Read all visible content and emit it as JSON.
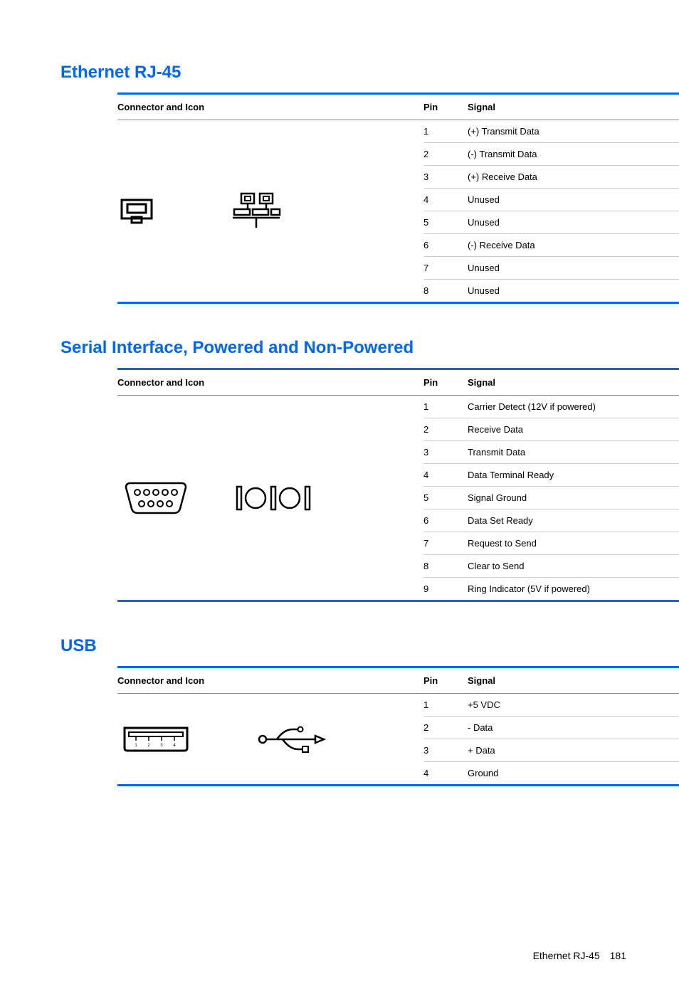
{
  "sections": [
    {
      "heading": "Ethernet RJ-45",
      "header": {
        "connector": "Connector and Icon",
        "pin": "Pin",
        "signal": "Signal"
      },
      "rows": [
        {
          "pin": "1",
          "signal": "(+) Transmit Data"
        },
        {
          "pin": "2",
          "signal": "(-) Transmit Data"
        },
        {
          "pin": "3",
          "signal": "(+) Receive Data"
        },
        {
          "pin": "4",
          "signal": "Unused"
        },
        {
          "pin": "5",
          "signal": "Unused"
        },
        {
          "pin": "6",
          "signal": "(-) Receive Data"
        },
        {
          "pin": "7",
          "signal": "Unused"
        },
        {
          "pin": "8",
          "signal": "Unused"
        }
      ]
    },
    {
      "heading": "Serial Interface, Powered and Non-Powered",
      "header": {
        "connector": "Connector and Icon",
        "pin": "Pin",
        "signal": "Signal"
      },
      "rows": [
        {
          "pin": "1",
          "signal": "Carrier Detect (12V if powered)"
        },
        {
          "pin": "2",
          "signal": "Receive Data"
        },
        {
          "pin": "3",
          "signal": "Transmit Data"
        },
        {
          "pin": "4",
          "signal": "Data Terminal Ready"
        },
        {
          "pin": "5",
          "signal": "Signal Ground"
        },
        {
          "pin": "6",
          "signal": "Data Set Ready"
        },
        {
          "pin": "7",
          "signal": "Request to Send"
        },
        {
          "pin": "8",
          "signal": "Clear to Send"
        },
        {
          "pin": "9",
          "signal": "Ring Indicator (5V if powered)"
        }
      ]
    },
    {
      "heading": "USB",
      "header": {
        "connector": "Connector and Icon",
        "pin": "Pin",
        "signal": "Signal"
      },
      "rows": [
        {
          "pin": "1",
          "signal": "+5 VDC"
        },
        {
          "pin": "2",
          "signal": "- Data"
        },
        {
          "pin": "3",
          "signal": "+ Data"
        },
        {
          "pin": "4",
          "signal": "Ground"
        }
      ]
    }
  ],
  "footer": {
    "title": "Ethernet RJ-45",
    "page": "181"
  }
}
